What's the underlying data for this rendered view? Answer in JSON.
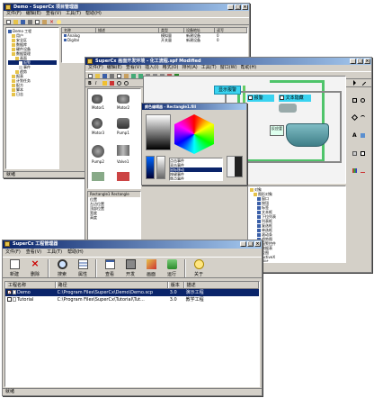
{
  "project_window": {
    "title": "Demo - SuperCx 项目管理器",
    "menu": [
      "文件(F)",
      "编辑(E)",
      "查看(V)",
      "工具(T)",
      "帮助(H)"
    ],
    "tree": [
      "Demo 工程",
      "用户",
      "安全区",
      "数据库",
      "硬件设备",
      "数据管理",
      "画面",
      "报警",
      "事件",
      "趋势",
      "报表",
      "计划任务",
      "配方",
      "脚本",
      "日志"
    ],
    "grid_headers": [
      "名称",
      "描述",
      "类型",
      "设备地址",
      "读写"
    ],
    "grid_rows": [
      {
        "name": "Analog",
        "desc": "",
        "type": "模拟量",
        "addr": "新建设备",
        "rw": "0"
      },
      {
        "name": "Digital",
        "desc": "",
        "type": "开关量",
        "addr": "新建设备",
        "rw": "0"
      }
    ],
    "status": "就绪"
  },
  "editor_window": {
    "title": "SuperCx 画面开发环境 - 化工流程.spf Modified",
    "menu": [
      "文件(F)",
      "编辑(E)",
      "查看(V)",
      "插入(I)",
      "格式(O)",
      "排列(A)",
      "工具(T)",
      "窗口(W)",
      "帮助(H)"
    ],
    "canvas": {
      "checkbox1_label": "报警",
      "checkbox2_label": "文本隐藏",
      "button_label": "显示报警",
      "tank_label": "反应釜"
    },
    "palette_labels": [
      "Motor1",
      "Motor2",
      "Motor3",
      "Pump1",
      "Pump2",
      "Valve1"
    ],
    "color_dialog_title": "颜色编辑器 - Rectangle1.fill",
    "props_title": "Rectangle1 Rectangle",
    "prop_rows": [
      "位置",
      "左边位置",
      "顶部位置",
      "宽度",
      "高度"
    ],
    "right_tree": [
      "对象",
      "图形对象",
      "窗口",
      "按钮",
      "标签",
      "文本框",
      "下拉列表",
      "列表框",
      "复选框",
      "单选框",
      "滚动条",
      "趋势图",
      "报警控件",
      "数据表",
      "位图",
      "ActiveX",
      "图片",
      "Motor"
    ],
    "event_list": [
      "点击事件",
      "双击事件",
      "鼠标移动",
      "按键事件",
      "焦点事件"
    ]
  },
  "manager_window": {
    "title": "SuperCx 工程管理器",
    "menu": [
      "文件(F)",
      "查看(V)",
      "工具(T)",
      "帮助(H)"
    ],
    "toolbar": [
      {
        "label": "新建",
        "icon": "new-icon"
      },
      {
        "label": "删除",
        "icon": "delete-icon"
      },
      {
        "label": "搜索",
        "icon": "search-icon"
      },
      {
        "label": "属性",
        "icon": "properties-icon"
      },
      {
        "label": "查看",
        "icon": "view-icon"
      },
      {
        "label": "开发",
        "icon": "develop-icon"
      },
      {
        "label": "画面",
        "icon": "screen-icon"
      },
      {
        "label": "运行",
        "icon": "run-icon"
      },
      {
        "label": "关于",
        "icon": "about-icon"
      }
    ],
    "headers": [
      "工程名称",
      "路径",
      "版本",
      "描述"
    ],
    "rows": [
      {
        "name": "Demo",
        "path": "C:\\Program Files\\SuperCx\\Demo\\Demo.scp",
        "version": "3.0",
        "desc": "演示工程",
        "selected": true
      },
      {
        "name": "Tutorial",
        "path": "C:\\Program Files\\SuperCx\\Tutorial\\Tut...",
        "version": "3.0",
        "desc": "教学工程",
        "selected": false
      }
    ],
    "status": "就绪"
  },
  "colors": {
    "title_dark": "#0a246a",
    "title_light": "#a6caf0",
    "chrome": "#d4d0c8",
    "canvas_bg": "#f3f3f3",
    "pipe_green": "#4fc46a",
    "tank_teal": "#5c9ea8",
    "button_cyan": "#39d3f0"
  }
}
